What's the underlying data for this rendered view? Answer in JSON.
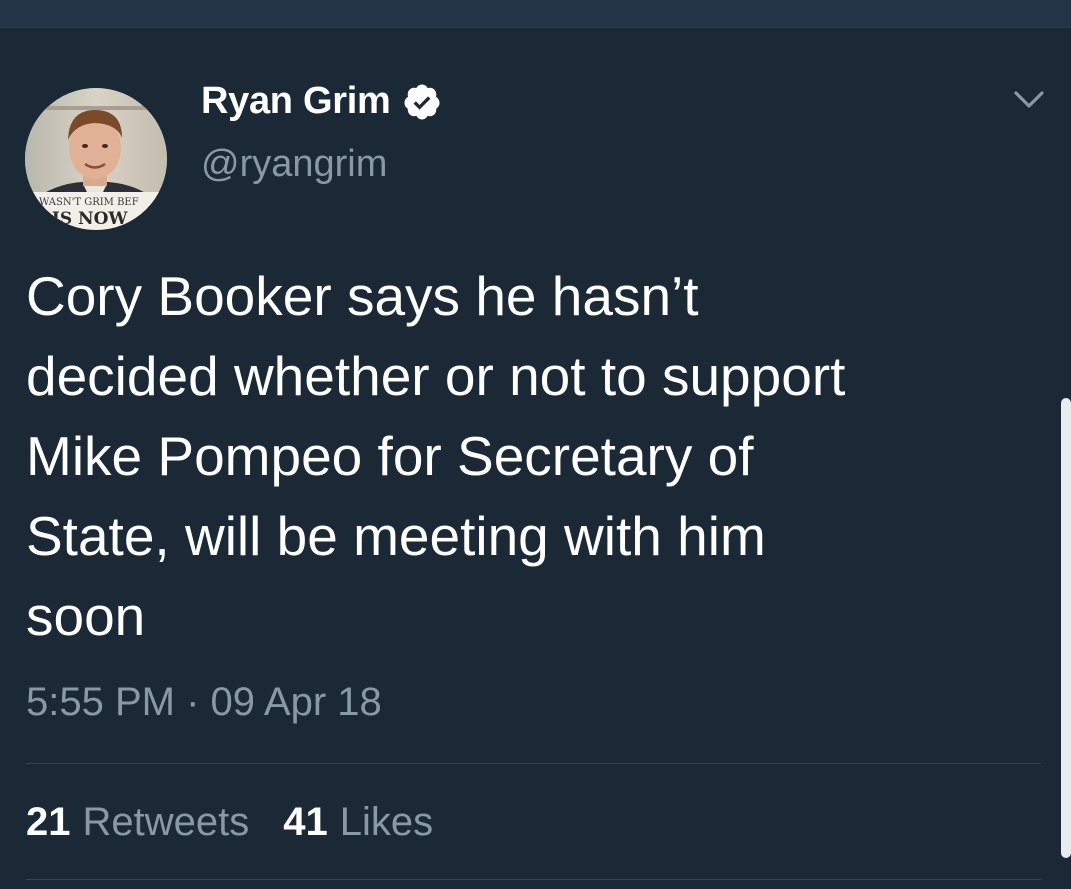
{
  "tweet": {
    "author": {
      "name": "Ryan Grim",
      "handle": "@ryangrim",
      "verified": true,
      "avatar_caption_line1": "WASN'T GRIM BEF",
      "avatar_caption_line2": "E IS NOW"
    },
    "text": "Cory Booker says he hasn’t\ndecided whether or not to support\nMike Pompeo for Secretary of\nState, will be meeting with him\nsoon",
    "timestamp": "5:55 PM · 09 Apr 18",
    "stats": {
      "retweets_count": "21",
      "retweets_label": "Retweets",
      "likes_count": "41",
      "likes_label": "Likes"
    }
  },
  "colors": {
    "background": "#1b2836",
    "secondary_text": "#8899a6",
    "verified_badge": "#ffffff"
  },
  "icons": {
    "verified": "verified-badge-icon",
    "menu": "chevron-down-icon"
  }
}
